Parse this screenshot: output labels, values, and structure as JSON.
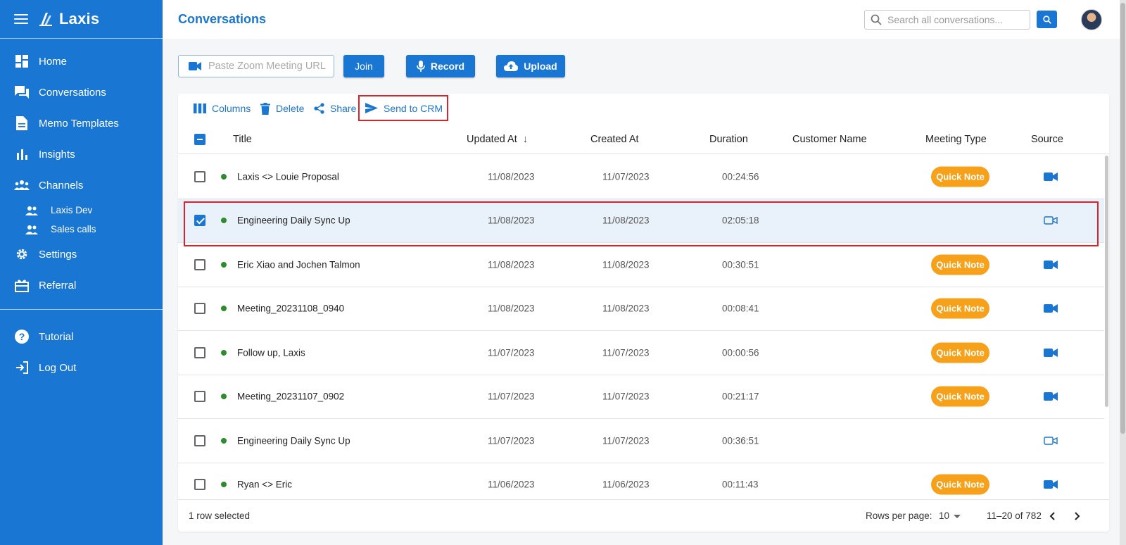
{
  "app": {
    "name": "Laxis"
  },
  "sidebar": {
    "items": [
      {
        "label": "Home",
        "icon": "dashboard-icon"
      },
      {
        "label": "Conversations",
        "icon": "chat-icon"
      },
      {
        "label": "Memo Templates",
        "icon": "document-icon"
      },
      {
        "label": "Insights",
        "icon": "bar-chart-icon"
      },
      {
        "label": "Channels",
        "icon": "people-icon"
      }
    ],
    "channels": [
      {
        "label": "Laxis Dev",
        "icon": "people-icon"
      },
      {
        "label": "Sales calls",
        "icon": "people-icon"
      }
    ],
    "settings": {
      "label": "Settings",
      "icon": "gear-icon"
    },
    "referral": {
      "label": "Referral",
      "icon": "gift-icon"
    },
    "tutorial": {
      "label": "Tutorial",
      "icon": "help-icon"
    },
    "logout": {
      "label": "Log Out",
      "icon": "logout-icon"
    }
  },
  "header": {
    "title": "Conversations",
    "search_placeholder": "Search all conversations..."
  },
  "actions": {
    "zoom_placeholder": "Paste Zoom Meeting URL",
    "join_label": "Join",
    "record_label": "Record",
    "upload_label": "Upload"
  },
  "toolbar": {
    "columns": "Columns",
    "delete": "Delete",
    "share": "Share",
    "send_to_crm": "Send to CRM"
  },
  "table": {
    "columns": [
      "Title",
      "Updated At",
      "Created At",
      "Duration",
      "Customer Name",
      "Meeting Type",
      "Source"
    ],
    "sort_indicator": "↓",
    "rows": [
      {
        "title": "Laxis <> Louie Proposal",
        "updated": "11/08/2023",
        "created": "11/07/2023",
        "duration": "00:24:56",
        "customer": "",
        "meeting_type": "Quick Note",
        "source": "zoom-video-icon",
        "selected": false
      },
      {
        "title": "Engineering Daily Sync Up",
        "updated": "11/08/2023",
        "created": "11/08/2023",
        "duration": "02:05:18",
        "customer": "",
        "meeting_type": "",
        "source": "video-outline-icon",
        "selected": true
      },
      {
        "title": "Eric Xiao and Jochen Talmon",
        "updated": "11/08/2023",
        "created": "11/08/2023",
        "duration": "00:30:51",
        "customer": "",
        "meeting_type": "Quick Note",
        "source": "zoom-video-icon",
        "selected": false
      },
      {
        "title": "Meeting_20231108_0940",
        "updated": "11/08/2023",
        "created": "11/08/2023",
        "duration": "00:08:41",
        "customer": "",
        "meeting_type": "Quick Note",
        "source": "zoom-video-icon",
        "selected": false
      },
      {
        "title": "Follow up, Laxis",
        "updated": "11/07/2023",
        "created": "11/07/2023",
        "duration": "00:00:56",
        "customer": "",
        "meeting_type": "Quick Note",
        "source": "zoom-video-icon",
        "selected": false
      },
      {
        "title": "Meeting_20231107_0902",
        "updated": "11/07/2023",
        "created": "11/07/2023",
        "duration": "00:21:17",
        "customer": "",
        "meeting_type": "Quick Note",
        "source": "zoom-video-icon",
        "selected": false
      },
      {
        "title": "Engineering Daily Sync Up",
        "updated": "11/07/2023",
        "created": "11/07/2023",
        "duration": "00:36:51",
        "customer": "",
        "meeting_type": "",
        "source": "video-outline-icon",
        "selected": false
      },
      {
        "title": "Ryan <> Eric",
        "updated": "11/06/2023",
        "created": "11/06/2023",
        "duration": "00:11:43",
        "customer": "",
        "meeting_type": "Quick Note",
        "source": "zoom-video-icon",
        "selected": false
      }
    ]
  },
  "footer": {
    "selected_text": "1 row selected",
    "rows_per_page_label": "Rows per page:",
    "rows_per_page_value": "10",
    "range_text": "11–20 of 782"
  },
  "colors": {
    "primary": "#1976d2",
    "badge": "#f7a11a",
    "status_dot": "#2e8b2e",
    "highlight": "#e0202a"
  }
}
